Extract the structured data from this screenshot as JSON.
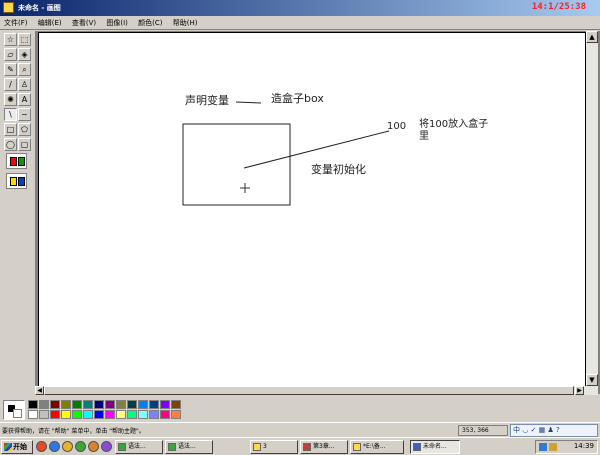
{
  "window": {
    "title": "未命名 - 画图",
    "clock": "14:1/25:38"
  },
  "menu": [
    "文件(F)",
    "编辑(E)",
    "查看(V)",
    "图像(I)",
    "颜色(C)",
    "帮助(H)"
  ],
  "tools": [
    {
      "glyph": "☆",
      "icon": "free-select-icon"
    },
    {
      "glyph": "⬚",
      "icon": "select-icon"
    },
    {
      "glyph": "▱",
      "icon": "eraser-icon"
    },
    {
      "glyph": "◈",
      "icon": "fill-icon"
    },
    {
      "glyph": "✎",
      "icon": "pick-color-icon"
    },
    {
      "glyph": "⌕",
      "icon": "magnifier-icon"
    },
    {
      "glyph": "/",
      "icon": "pencil-icon"
    },
    {
      "glyph": "♙",
      "icon": "brush-icon"
    },
    {
      "glyph": "✺",
      "icon": "airbrush-icon"
    },
    {
      "glyph": "A",
      "icon": "text-icon"
    },
    {
      "glyph": "\\",
      "icon": "line-icon"
    },
    {
      "glyph": "~",
      "icon": "curve-icon"
    },
    {
      "glyph": "□",
      "icon": "rectangle-icon"
    },
    {
      "glyph": "⬠",
      "icon": "polygon-icon"
    },
    {
      "glyph": "◯",
      "icon": "ellipse-icon"
    },
    {
      "glyph": "▢",
      "icon": "rounded-rect-icon"
    }
  ],
  "canvas": {
    "label_declare": "声明变量",
    "label_box": "造盒子box",
    "label_value": "100",
    "label_put_line1": "将100放入盒子",
    "label_put_line2": "里",
    "label_init": "变量初始化"
  },
  "palette": [
    "#000000",
    "#808080",
    "#800000",
    "#808000",
    "#008000",
    "#008080",
    "#000080",
    "#800080",
    "#808040",
    "#004040",
    "#0080ff",
    "#004080",
    "#8000ff",
    "#804000",
    "#ffffff",
    "#c0c0c0",
    "#ff0000",
    "#ffff00",
    "#00ff00",
    "#00ffff",
    "#0000ff",
    "#ff00ff",
    "#ffff80",
    "#00ff80",
    "#80ffff",
    "#8080ff",
    "#ff0080",
    "#ff8040"
  ],
  "status": {
    "help_text": "要获得帮助，请在 \"帮助\" 菜单中，单击 \"帮助主题\"。",
    "coords": "353, 366",
    "ime": "中 ◡ ✓ ▦ ♟ ?"
  },
  "taskbar": {
    "start": "开始",
    "quick_launch_colors": [
      "#e6482a",
      "#2a7ae6",
      "#e6b32a",
      "#3aa63a",
      "#d9822a",
      "#8a4ad9"
    ],
    "tasks": [
      {
        "label": "语法...",
        "color": "#3aa63a"
      },
      {
        "label": "语法...",
        "color": "#3aa63a"
      },
      {
        "label": "3",
        "color": "#ffd84a"
      },
      {
        "label": "第3章...",
        "color": "#c04040"
      },
      {
        "label": "*E:\\备...",
        "color": "#ffd84a"
      },
      {
        "label": "未命名...",
        "color": "#4060c0"
      }
    ],
    "time": "14:39"
  }
}
